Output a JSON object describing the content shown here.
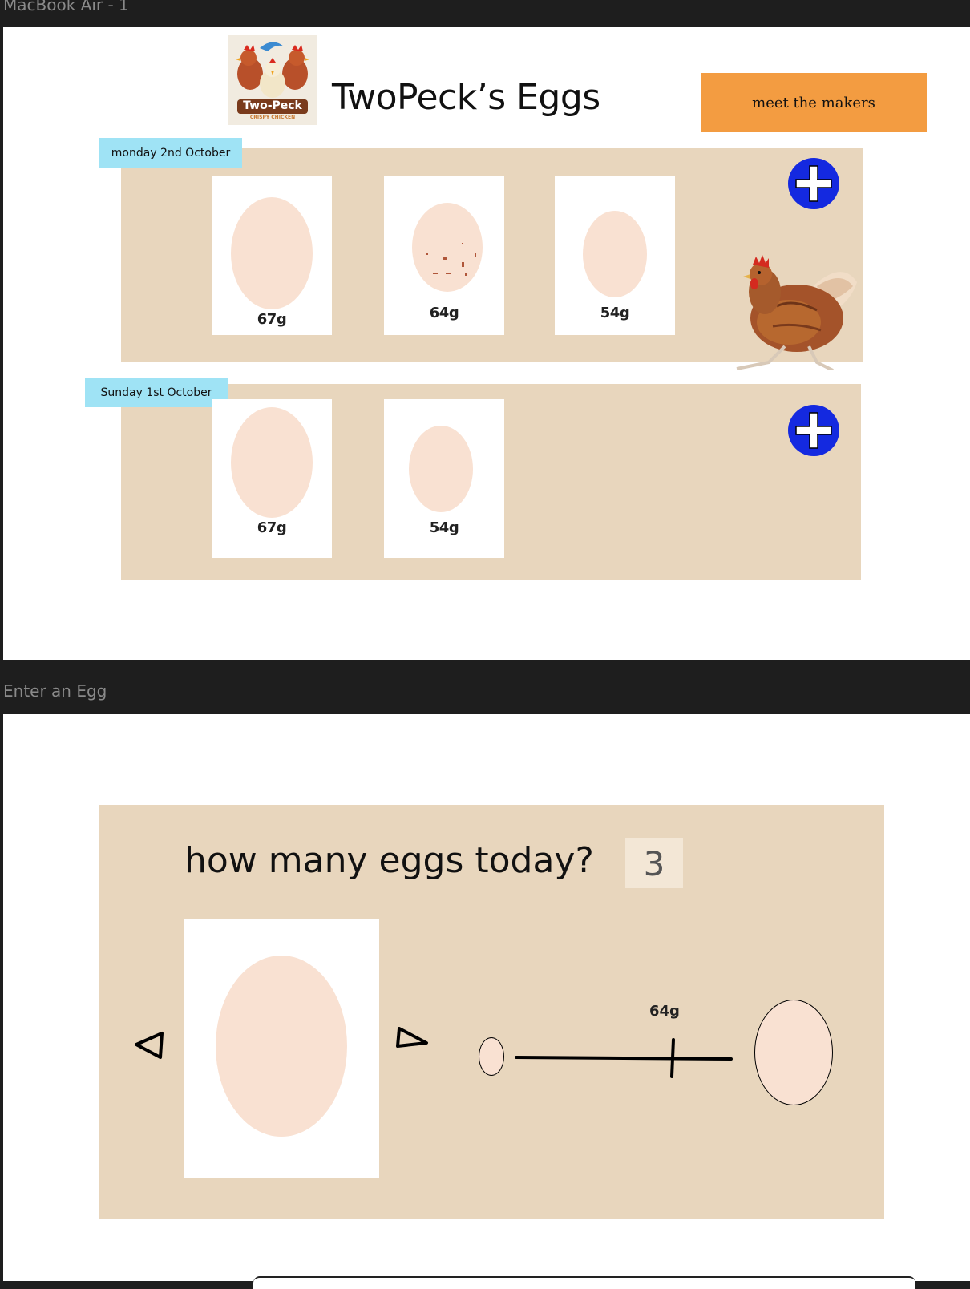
{
  "frames": {
    "frame1_label": "MacBook Air - 1",
    "frame2_label": "Enter an Egg"
  },
  "header": {
    "logo_text": "Two-Peck",
    "logo_subtext": "CRISPY CHICKEN",
    "title": "TwoPeck’s Eggs",
    "meet_button": "meet the makers"
  },
  "days": [
    {
      "date": "monday 2nd October",
      "eggs": [
        {
          "weight": "67g"
        },
        {
          "weight": "64g"
        },
        {
          "weight": "54g"
        }
      ]
    },
    {
      "date": "Sunday 1st October",
      "eggs": [
        {
          "weight": "67g"
        },
        {
          "weight": "54g"
        }
      ]
    }
  ],
  "entry": {
    "question": "how many eggs today?",
    "count": "3",
    "slider_value": "64g"
  },
  "icons": {
    "add": "plus-circle-icon",
    "prev": "left-triangle-icon",
    "next": "right-triangle-icon",
    "hen": "hen-image"
  },
  "colors": {
    "panel": "#e8d6bd",
    "egg": "#f9e1d2",
    "date_label": "#9fe3f5",
    "button": "#f39c41",
    "add": "#1429e0"
  }
}
